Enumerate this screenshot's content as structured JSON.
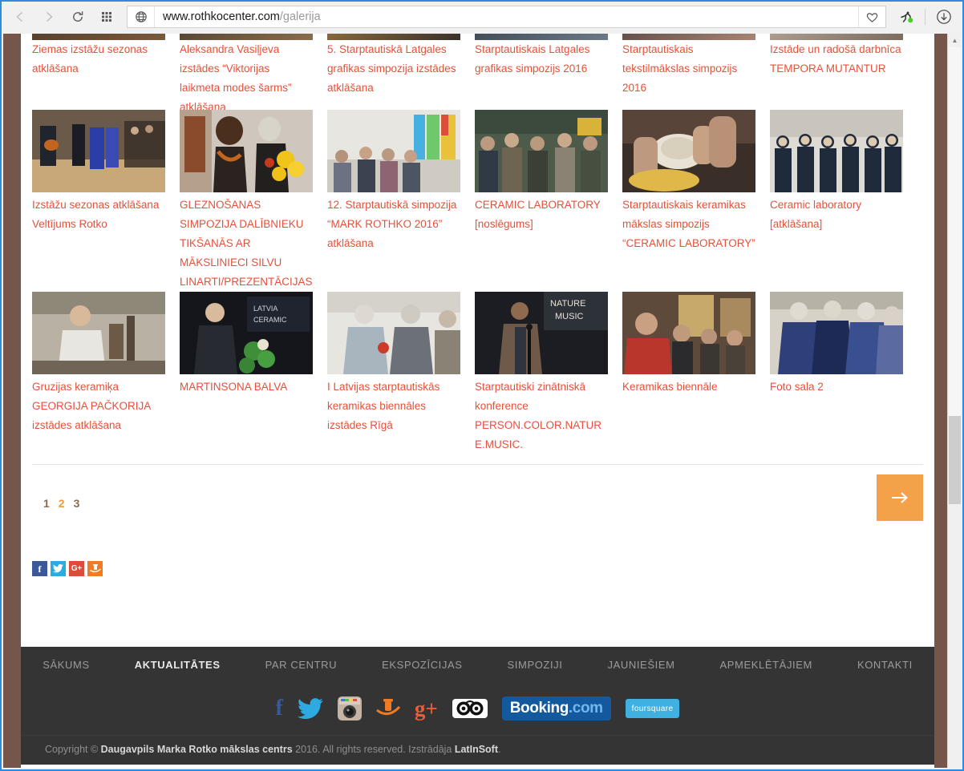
{
  "browser": {
    "back_icon": "chevron-left-icon",
    "forward_icon": "chevron-right-icon",
    "reload_icon": "reload-icon",
    "speeddial_icon": "grid-icon",
    "site_icon": "globe-icon",
    "url_host": "www.rothkocenter.com",
    "url_path": "/galerija",
    "url_full": "www.rothkocenter.com/galerija",
    "bookmark_icon": "heart-icon",
    "extension_icon": "runner-icon",
    "download_icon": "download-icon"
  },
  "gallery": {
    "rows": [
      {
        "items": [
          {
            "caption": "Ziemas izstāžu sezonas atklāšana"
          },
          {
            "caption": "Aleksandra Vasiļjeva izstādes “Viktorijas laikmeta modes šarms” atklāšana"
          },
          {
            "caption": "5. Starptautiskā Latgales grafikas simpozija izstādes atklāšana"
          },
          {
            "caption": "Starptautiskais Latgales grafikas simpozijs 2016"
          },
          {
            "caption": "Starptautiskais tekstilmākslas simpozijs 2016"
          },
          {
            "caption": "Izstāde un radošā darbnīca TEMPORA MUTANTUR"
          }
        ]
      },
      {
        "items": [
          {
            "caption": "Izstāžu sezonas atklāšana Veltījums Rotko"
          },
          {
            "caption": "GLEZNOŠANAS SIMPOZIJA DALĪBNIEKU TIKŠANĀS AR MĀKSLINIECI SILVU LINARTI/PREZENTĀCIJAS"
          },
          {
            "caption": "12. Starptautiskā simpozija “MARK ROTHKO 2016” atklāšana"
          },
          {
            "caption": "CERAMIC LABORATORY [noslēgums]"
          },
          {
            "caption": "Starptautiskais keramikas mākslas simpozijs “CERAMIC LABORATORY”"
          },
          {
            "caption": "Ceramic laboratory [atklāšana]"
          }
        ]
      },
      {
        "items": [
          {
            "caption": "Gruzijas keramiķa GEORGIJA PAČKORIJA izstādes atklāšana"
          },
          {
            "caption": "MARTINSONA BALVA"
          },
          {
            "caption": "I Latvijas starptautiskās keramikas biennāles izstādes Rīgā"
          },
          {
            "caption": "Starptautiski zinātniskā konference PERSON.COLOR.NATURE.MUSIC."
          },
          {
            "caption": "Keramikas biennāle"
          },
          {
            "caption": "Foto sala 2"
          }
        ]
      }
    ]
  },
  "pagination": {
    "pages": [
      "1",
      "2",
      "3"
    ],
    "active": "2",
    "next_icon": "arrow-right-icon",
    "next_label": ""
  },
  "share": {
    "buttons": [
      {
        "name": "facebook",
        "glyph": "f"
      },
      {
        "name": "twitter",
        "glyph": ""
      },
      {
        "name": "google-plus",
        "glyph": "G+"
      },
      {
        "name": "draugiem",
        "glyph": ""
      }
    ]
  },
  "footer": {
    "nav": [
      {
        "label": "SĀKUMS",
        "active": false
      },
      {
        "label": "AKTUALITĀTES",
        "active": true
      },
      {
        "label": "PAR CENTRU",
        "active": false
      },
      {
        "label": "EKSPOZĪCIJAS",
        "active": false
      },
      {
        "label": "SIMPOZIJI",
        "active": false
      },
      {
        "label": "JAUNIEŠIEM",
        "active": false
      },
      {
        "label": "APMEKLĒTĀJIEM",
        "active": false
      },
      {
        "label": "KONTAKTI",
        "active": false
      }
    ],
    "social": [
      {
        "name": "facebook-icon",
        "label": "f"
      },
      {
        "name": "twitter-icon",
        "label": ""
      },
      {
        "name": "instagram-icon",
        "label": ""
      },
      {
        "name": "draugiem-icon",
        "label": ""
      },
      {
        "name": "google-plus-icon",
        "label": "g+"
      },
      {
        "name": "tripadvisor-icon",
        "label": ""
      },
      {
        "name": "booking-icon",
        "label": "Booking",
        "label2": ".com"
      },
      {
        "name": "foursquare-icon",
        "label": "foursquare"
      }
    ],
    "copyright_pre": "Copyright © ",
    "copyright_org": "Daugavpils Marka Rotko mākslas centrs",
    "copyright_mid": " 2016. All rights reserved. Izstrādāja ",
    "copyright_dev": "LatInSoft",
    "copyright_end": "."
  },
  "colors": {
    "accent_orange": "#f4a24a",
    "link_red": "#e8503a",
    "page_bg_brown": "#76564a",
    "footer_dark": "#343434"
  }
}
